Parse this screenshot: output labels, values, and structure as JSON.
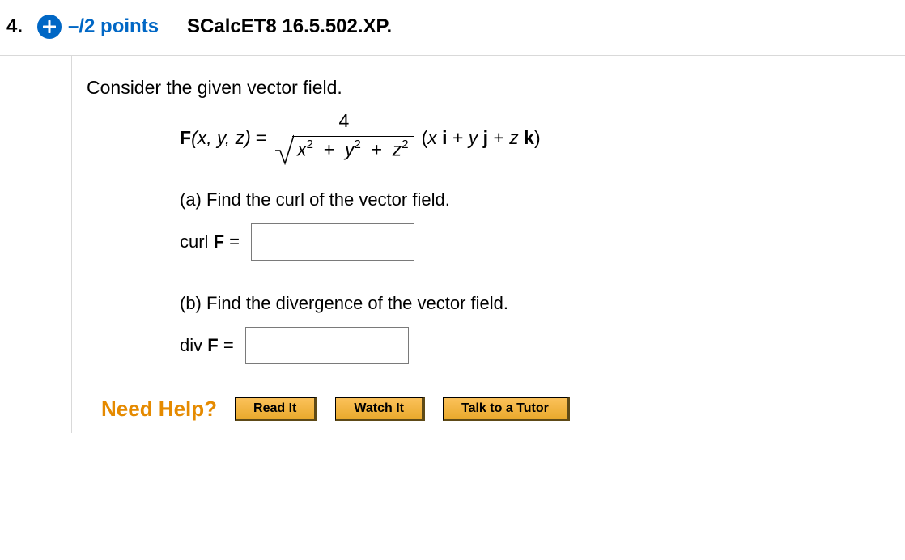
{
  "header": {
    "number": "4.",
    "points_text": "–/2 points",
    "source": "SCalcET8 16.5.502.XP."
  },
  "prompt": "Consider the given vector field.",
  "equation": {
    "lhs_func": "F",
    "lhs_args": "(x, y, z)",
    "numerator": "4",
    "radicand_x": "x",
    "radicand_y": "y",
    "radicand_z": "z",
    "plus": "+",
    "components": "(x i + y j + z k)"
  },
  "parts": {
    "a": {
      "text": "(a) Find the curl of the vector field.",
      "label": "curl",
      "symbol": "F",
      "equals": "="
    },
    "b": {
      "text": "(b) Find the divergence of the vector field.",
      "label": "div",
      "symbol": "F",
      "equals": "="
    }
  },
  "help": {
    "label": "Need Help?",
    "read": "Read It",
    "watch": "Watch It",
    "tutor": "Talk to a Tutor"
  }
}
